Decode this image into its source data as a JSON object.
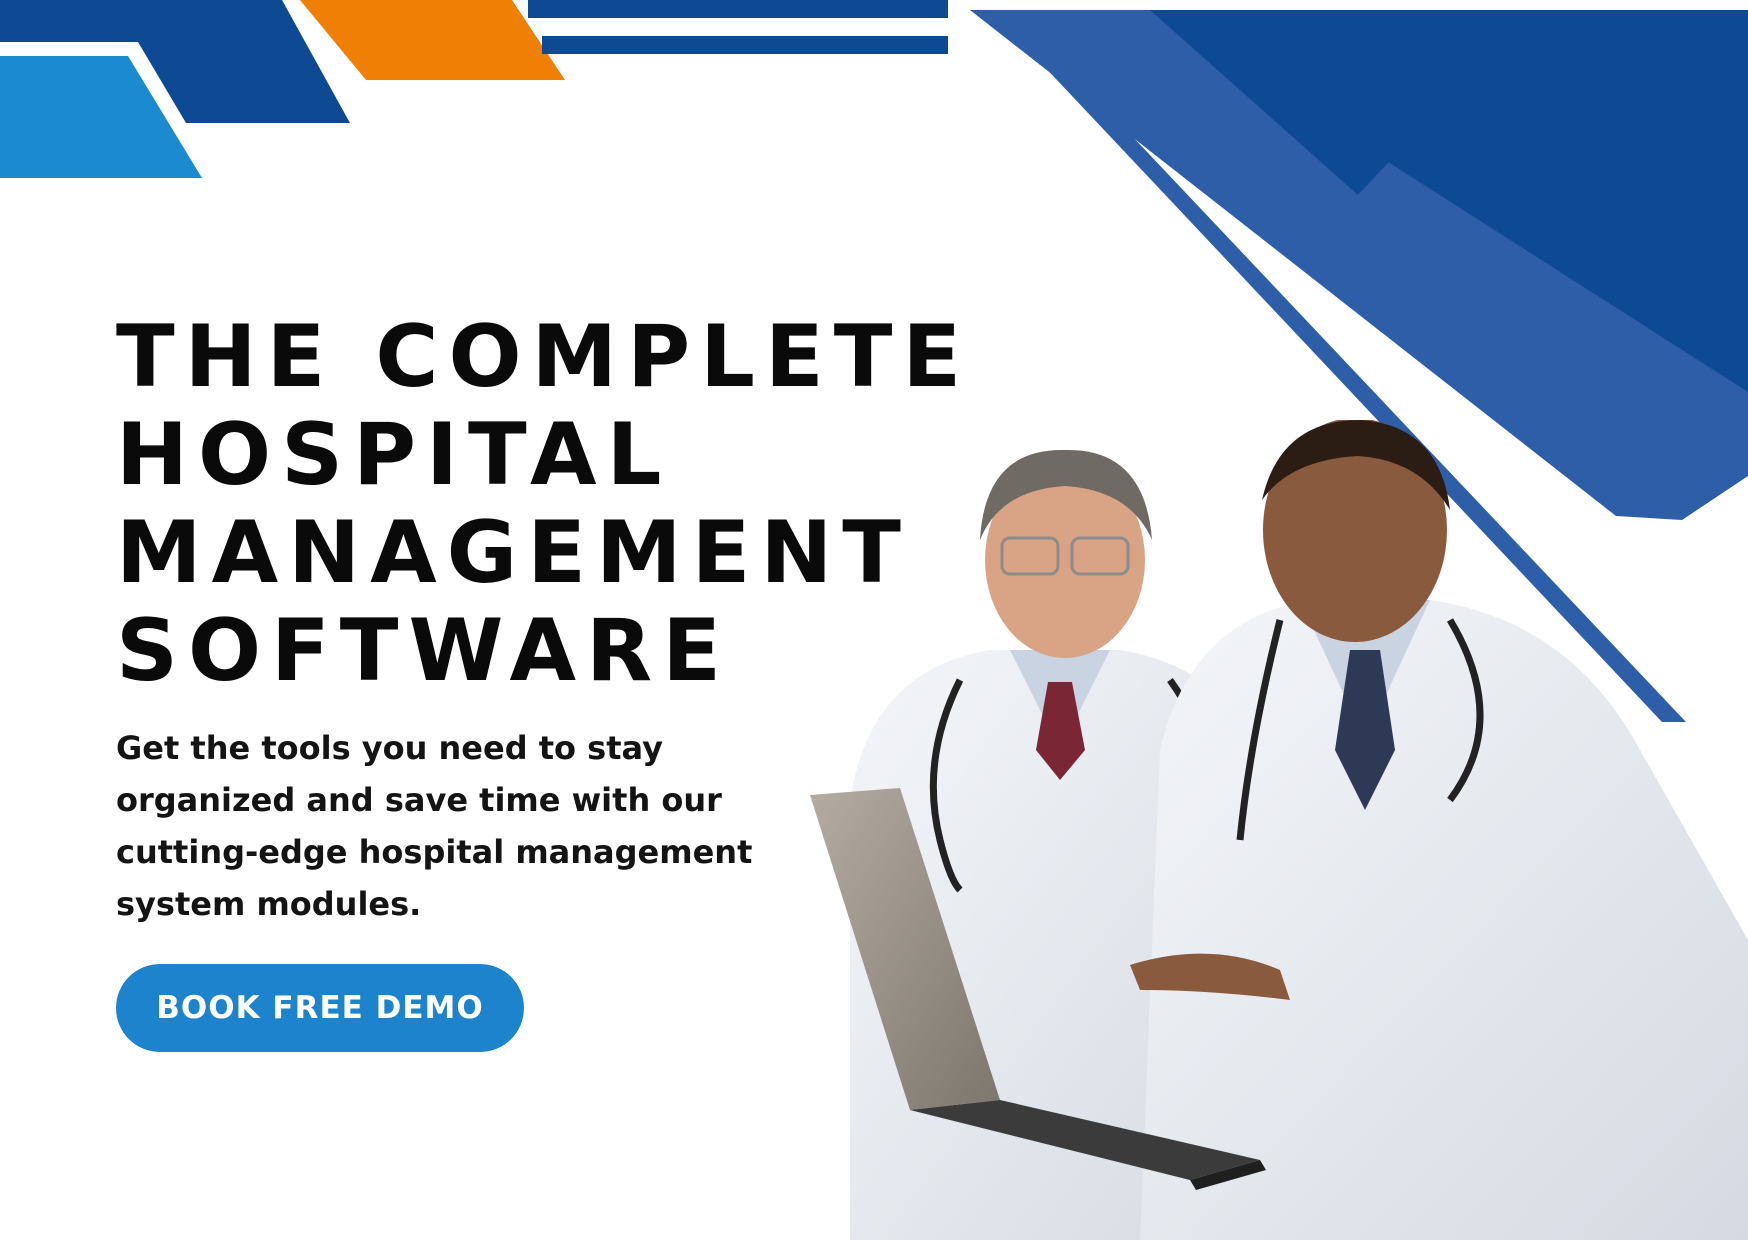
{
  "hero": {
    "headline_lines": [
      "THE COMPLETE",
      "HOSPITAL",
      "MANAGEMENT",
      "SOFTWARE"
    ],
    "subtext": "Get the tools you need to stay organized and save time with our cutting-edge hospital management system modules.",
    "cta_label": "BOOK FREE DEMO"
  },
  "colors": {
    "navy": "#0d4a93",
    "blue": "#2f5ea8",
    "sky": "#1b8ad0",
    "orange": "#ef8005",
    "button": "#1c83cc",
    "text": "#0a0a0a"
  },
  "image": {
    "subject": "two-doctors-with-laptop-photo"
  }
}
